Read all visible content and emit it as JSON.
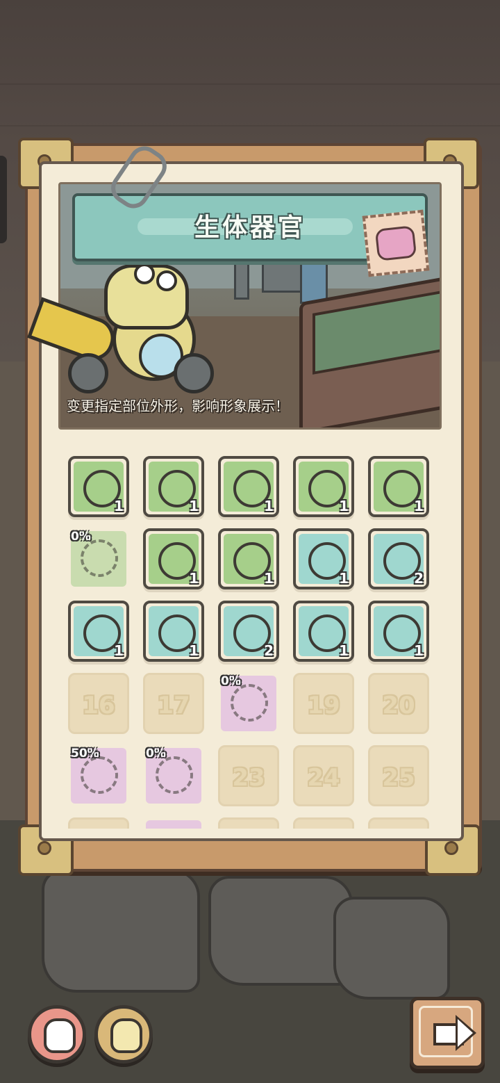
{
  "header": {
    "title": "生体器官",
    "description": "变更指定部位外形，影响形象展示！"
  },
  "icons": {
    "stamp": "organ-stamp-icon",
    "clip": "paper-clip-icon"
  },
  "grid": {
    "rows": [
      [
        {
          "kind": "owned",
          "icon": "claw-hand-icon",
          "color": "#a6cf8a",
          "count": "1"
        },
        {
          "kind": "owned",
          "icon": "mech-eye-icon",
          "color": "#a6cf8a",
          "count": "1"
        },
        {
          "kind": "owned",
          "icon": "eyeball-collar-icon",
          "color": "#a6cf8a",
          "count": "1"
        },
        {
          "kind": "owned",
          "icon": "spiked-antenna-icon",
          "color": "#a6cf8a",
          "count": "1"
        },
        {
          "kind": "owned",
          "icon": "drill-arm-icon",
          "color": "#a6cf8a",
          "count": "1"
        }
      ],
      [
        {
          "kind": "partial",
          "icon": "map-scrap-icon",
          "color": "#c9dcaf",
          "percent": "0%"
        },
        {
          "kind": "owned",
          "icon": "eye-stalk-icon",
          "color": "#a6cf8a",
          "count": "1"
        },
        {
          "kind": "owned",
          "icon": "cloth-patch-icon",
          "color": "#a6cf8a",
          "count": "1"
        },
        {
          "kind": "owned",
          "icon": "folded-armor-icon",
          "color": "#9fd7cf",
          "count": "1"
        },
        {
          "kind": "owned",
          "icon": "power-core-icon",
          "color": "#9fd7cf",
          "count": "2"
        }
      ],
      [
        {
          "kind": "owned",
          "icon": "goggles-icon",
          "color": "#9fd7cf",
          "count": "1"
        },
        {
          "kind": "owned",
          "icon": "antenna-helmet-icon",
          "color": "#9fd7cf",
          "count": "1"
        },
        {
          "kind": "owned",
          "icon": "drill-bit-icon",
          "color": "#9fd7cf",
          "count": "2"
        },
        {
          "kind": "owned",
          "icon": "cannon-block-icon",
          "color": "#9fd7cf",
          "count": "1"
        },
        {
          "kind": "owned",
          "icon": "worm-eye-icon",
          "color": "#9fd7cf",
          "count": "1"
        }
      ],
      [
        {
          "kind": "locked",
          "number": "16"
        },
        {
          "kind": "locked",
          "number": "17"
        },
        {
          "kind": "partial",
          "icon": "tentacle-device-icon",
          "color": "#e6c8e0",
          "percent": "0%"
        },
        {
          "kind": "locked",
          "number": "19"
        },
        {
          "kind": "locked",
          "number": "20"
        }
      ],
      [
        {
          "kind": "partial",
          "icon": "brain-eye-icon",
          "color": "#e6c8e0",
          "percent": "50%"
        },
        {
          "kind": "partial",
          "icon": "crystal-ring-icon",
          "color": "#e6c8e0",
          "percent": "0%"
        },
        {
          "kind": "locked",
          "number": "23"
        },
        {
          "kind": "locked",
          "number": "24"
        },
        {
          "kind": "locked",
          "number": "25"
        }
      ],
      [
        {
          "kind": "locked",
          "number": ""
        },
        {
          "kind": "partial",
          "icon": "unknown-item-icon",
          "color": "#e6c8e0",
          "percent": ""
        },
        {
          "kind": "locked",
          "number": ""
        },
        {
          "kind": "locked",
          "number": ""
        },
        {
          "kind": "locked",
          "number": ""
        }
      ]
    ]
  },
  "footer": {
    "left_button_icon": "organ-creature-icon",
    "middle_button_icon": "smiley-creature-icon",
    "next_button_icon": "arrow-right-icon"
  },
  "colors": {
    "title_bar": "#8cc7bd",
    "board": "#c89a6b",
    "panel": "#f4ecd8",
    "left_button": "#e9968a",
    "middle_button": "#d9b879"
  }
}
